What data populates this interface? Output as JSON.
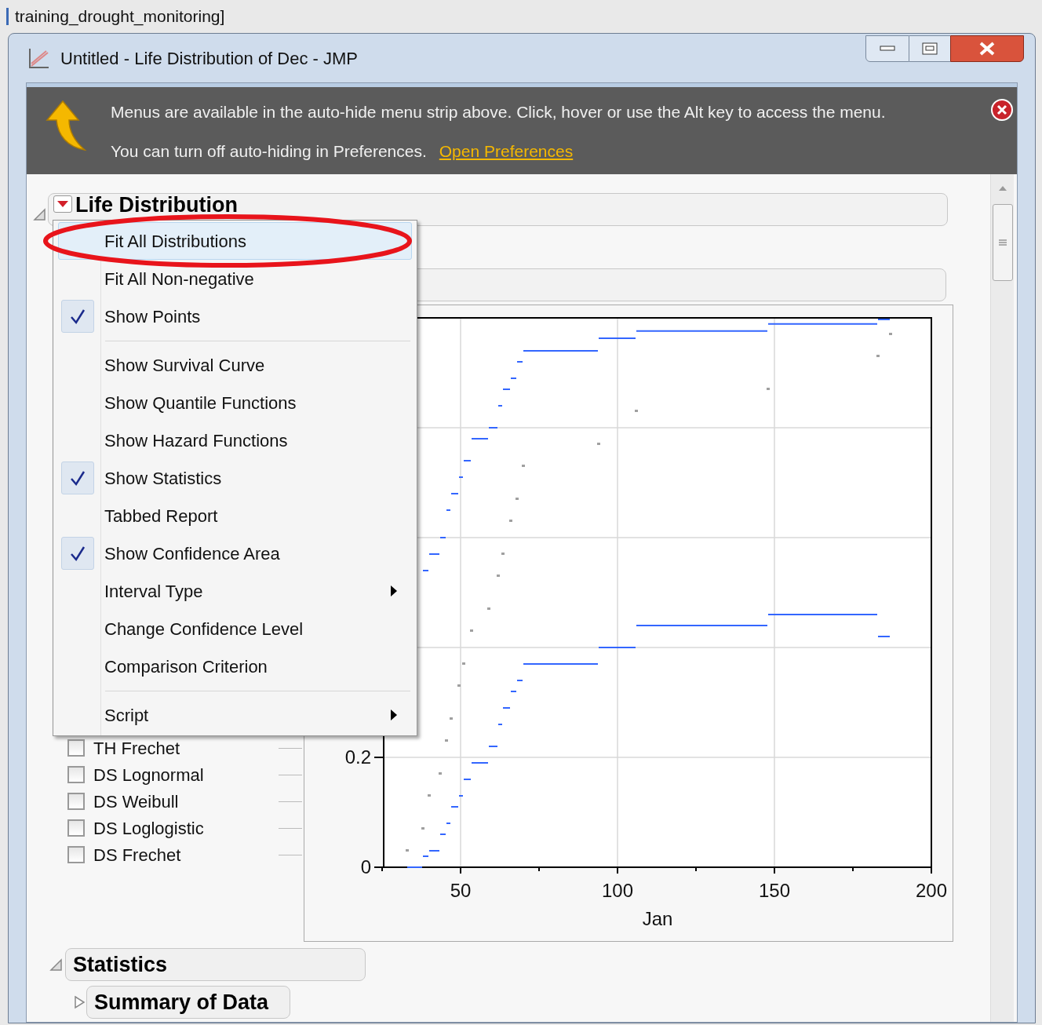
{
  "desktop": {
    "caption": "training_drought_monitoring]"
  },
  "window": {
    "title": "Untitled - Life Distribution of Dec - JMP"
  },
  "info_bar": {
    "line_1": "Menus are available in the auto-hide menu strip above. Click, hover or use the Alt key to access the menu.",
    "line_2": "You can turn off auto-hiding in Preferences.",
    "link": "Open Preferences"
  },
  "report": {
    "title": "Life Distribution",
    "expanded": true
  },
  "legend": [
    {
      "label": "TH Frechet",
      "checked": false
    },
    {
      "label": "DS Lognormal",
      "checked": false
    },
    {
      "label": "DS Weibull",
      "checked": false
    },
    {
      "label": "DS Loglogistic",
      "checked": false
    },
    {
      "label": "DS Frechet",
      "checked": false
    }
  ],
  "chart": {
    "chart_data": {
      "type": "line",
      "grid": true,
      "xlabel": "Jan",
      "xlim": [
        25.5,
        200
      ],
      "ylim": [
        0,
        1
      ],
      "xticks": [
        50,
        100,
        150,
        200
      ],
      "yticks": [
        0,
        0.2
      ],
      "x": [
        33,
        37.75,
        38,
        39.75,
        40,
        43.25,
        43.5,
        45.25,
        45.5,
        46.75,
        47,
        49.25,
        49.5,
        50.75,
        51,
        53.25,
        53.5,
        58.75,
        59,
        61.75,
        62,
        63.25,
        63.5,
        65.75,
        66,
        67.75,
        68,
        69.75,
        70,
        93.75,
        94,
        105.75,
        106,
        147.75,
        148,
        182.75,
        183,
        186.75,
        187
      ],
      "series": [
        {
          "type": "scatter",
          "color": "#a0a0a0",
          "values": [
            0.03,
            null,
            0.07,
            null,
            0.13,
            null,
            0.17,
            null,
            0.23,
            null,
            0.27,
            null,
            0.33,
            null,
            0.37,
            null,
            0.43,
            null,
            0.47,
            null,
            0.53,
            null,
            0.57,
            null,
            0.63,
            null,
            0.67,
            null,
            0.73,
            null,
            0.77,
            null,
            0.83,
            null,
            0.87,
            null,
            0.93,
            null,
            0.97
          ]
        },
        {
          "color": "#3366ff",
          "values": [
            0,
            0,
            null,
            null,
            0.03,
            0.03,
            null,
            null,
            0.08,
            0.08,
            null,
            null,
            0.13,
            0.13,
            null,
            null,
            0.19,
            0.19,
            null,
            null,
            0.26,
            0.26,
            null,
            null,
            0.32,
            0.32,
            null,
            null,
            0.37,
            0.37,
            null,
            null,
            0.44,
            0.44,
            null,
            null,
            0.42,
            0.42,
            null
          ]
        },
        {
          "color": "#3366ff",
          "values": [
            null,
            null,
            0.02,
            0.02,
            null,
            null,
            0.06,
            0.06,
            null,
            null,
            0.11,
            0.11,
            null,
            null,
            0.16,
            0.16,
            null,
            null,
            0.22,
            0.22,
            null,
            null,
            0.29,
            0.29,
            null,
            null,
            0.34,
            0.34,
            null,
            null,
            0.4,
            0.4,
            null,
            null,
            0.46,
            0.46,
            null,
            null,
            null
          ]
        },
        {
          "color": "#3366ff",
          "values": [
            null,
            null,
            null,
            null,
            0.57,
            0.57,
            null,
            null,
            0.65,
            0.65,
            null,
            null,
            0.71,
            0.71,
            null,
            null,
            0.78,
            0.78,
            null,
            null,
            0.84,
            0.84,
            null,
            null,
            0.89,
            0.89,
            null,
            null,
            0.94,
            0.94,
            null,
            null,
            0.976,
            0.976,
            null,
            null,
            0.997,
            0.997,
            null
          ]
        },
        {
          "color": "#3366ff",
          "values": [
            null,
            null,
            0.54,
            0.54,
            null,
            null,
            0.6,
            0.6,
            null,
            null,
            0.68,
            0.68,
            null,
            null,
            0.74,
            0.74,
            null,
            null,
            0.8,
            0.8,
            null,
            null,
            0.87,
            0.87,
            null,
            null,
            0.92,
            0.92,
            null,
            null,
            0.963,
            0.963,
            null,
            null,
            0.989,
            0.989,
            null,
            null,
            null
          ]
        }
      ]
    }
  },
  "statistics": {
    "title": "Statistics",
    "expanded": true,
    "children": [
      {
        "title": "Summary of Data",
        "expanded": false
      }
    ]
  },
  "context_menu": [
    {
      "kind": "item",
      "label": "Fit All Distributions",
      "checked": false,
      "highlighted": true,
      "circled": true,
      "submenu": false
    },
    {
      "kind": "item",
      "label": "Fit All Non-negative",
      "checked": false,
      "highlighted": false,
      "circled": false,
      "submenu": false
    },
    {
      "kind": "item",
      "label": "Show Points",
      "checked": true,
      "highlighted": false,
      "circled": false,
      "submenu": false
    },
    {
      "kind": "separator"
    },
    {
      "kind": "item",
      "label": "Show Survival Curve",
      "checked": false,
      "highlighted": false,
      "circled": false,
      "submenu": false
    },
    {
      "kind": "item",
      "label": "Show Quantile Functions",
      "checked": false,
      "highlighted": false,
      "circled": false,
      "submenu": false
    },
    {
      "kind": "item",
      "label": "Show Hazard Functions",
      "checked": false,
      "highlighted": false,
      "circled": false,
      "submenu": false
    },
    {
      "kind": "item",
      "label": "Show Statistics",
      "checked": true,
      "highlighted": false,
      "circled": false,
      "submenu": false
    },
    {
      "kind": "item",
      "label": "Tabbed Report",
      "checked": false,
      "highlighted": false,
      "circled": false,
      "submenu": false
    },
    {
      "kind": "item",
      "label": "Show Confidence Area",
      "checked": true,
      "highlighted": false,
      "circled": false,
      "submenu": false
    },
    {
      "kind": "item",
      "label": "Interval Type",
      "checked": false,
      "highlighted": false,
      "circled": false,
      "submenu": true
    },
    {
      "kind": "item",
      "label": "Change Confidence Level",
      "checked": false,
      "highlighted": false,
      "circled": false,
      "submenu": false
    },
    {
      "kind": "item",
      "label": "Comparison Criterion",
      "checked": false,
      "highlighted": false,
      "circled": false,
      "submenu": false
    },
    {
      "kind": "separator"
    },
    {
      "kind": "item",
      "label": "Script",
      "checked": false,
      "highlighted": false,
      "circled": false,
      "submenu": true
    }
  ]
}
